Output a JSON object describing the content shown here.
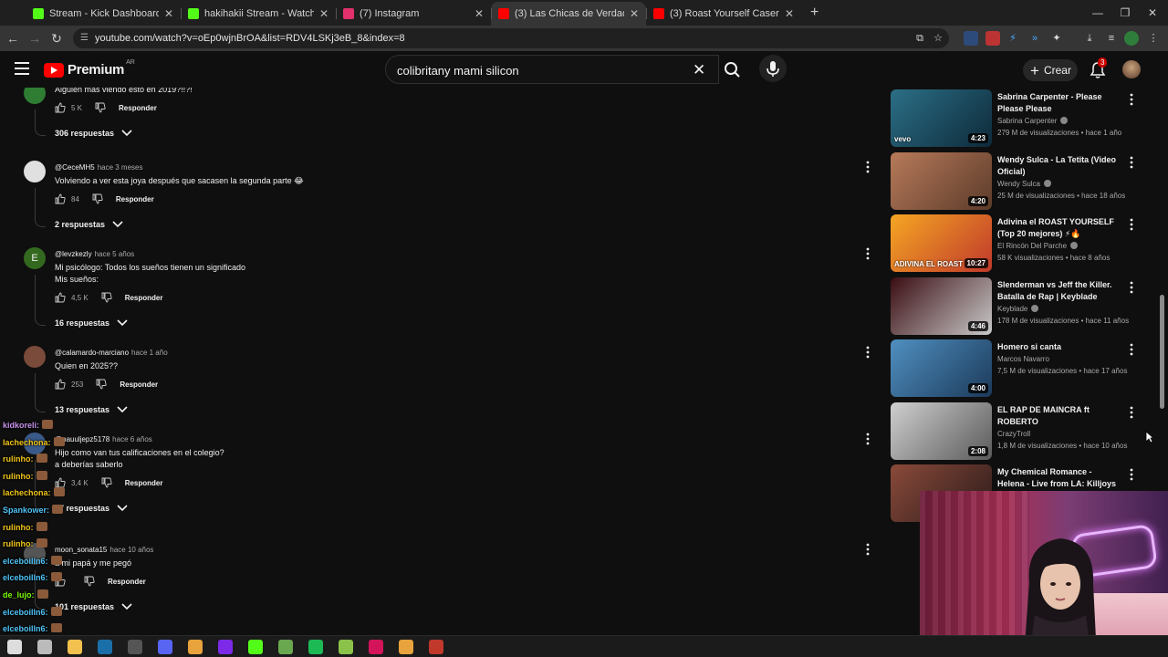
{
  "browser": {
    "tabs": [
      {
        "label": "Stream - Kick Dashboard",
        "favicon_color": "#53fc18",
        "active": false
      },
      {
        "label": "hakihakii Stream - Watch Live o",
        "favicon_color": "#53fc18",
        "active": false
      },
      {
        "label": "(7) Instagram",
        "favicon_color": "#e1306c",
        "active": false
      },
      {
        "label": "(3) Las Chicas de Verdad nos G",
        "favicon_color": "#ff0000",
        "active": true
      },
      {
        "label": "(3) Roast Yourself Casero - La F",
        "favicon_color": "#ff0000",
        "active": false
      }
    ],
    "url": "youtube.com/watch?v=oEp0wjnBrOA&list=RDV4LSKj3eB_8&index=8"
  },
  "youtube": {
    "logo_text": "Premium",
    "country_code": "AR",
    "search_value": "colibritany mami silicon",
    "create_label": "Crear",
    "notification_count": "3"
  },
  "comments": [
    {
      "author": "",
      "time": "",
      "text": [
        "Alguien mas viendo esto en 2019?!!?!"
      ],
      "likes": "5 K",
      "reply_label": "Responder",
      "replies": "306 respuestas",
      "avatar_color": "#2e7d32",
      "avatar_letter": ""
    },
    {
      "author": "@CeceMH5",
      "time": "hace 3 meses",
      "text": [
        "Volviendo a ver esta joya después que sacasen la segunda parte 😂"
      ],
      "likes": "84",
      "reply_label": "Responder",
      "replies": "2 respuestas",
      "avatar_color": "#e0e0e0",
      "avatar_letter": ""
    },
    {
      "author": "@levzkezly",
      "time": "hace 5 años",
      "text": [
        "Mi psicólogo: Todos los sueños tienen un significado",
        "Mis sueños:"
      ],
      "likes": "4,5 K",
      "reply_label": "Responder",
      "replies": "16 respuestas",
      "avatar_color": "#33691e",
      "avatar_letter": "E"
    },
    {
      "author": "@calamardo-marciano",
      "time": "hace 1 año",
      "text": [
        "Quien en 2025??"
      ],
      "likes": "253",
      "reply_label": "Responder",
      "replies": "13 respuestas",
      "avatar_color": "#7a4a3a",
      "avatar_letter": ""
    },
    {
      "author": "@nauuljepz5178",
      "time": "hace 6 años",
      "text": [
        "Hijo como van tus calificaciones en el colegio?",
        "a deberías saberlo"
      ],
      "likes": "3,4 K",
      "reply_label": "Responder",
      "replies": "17 respuestas",
      "avatar_color": "#3a5a8a",
      "avatar_letter": ""
    },
    {
      "author": "moon_sonata15",
      "time": "hace 10 años",
      "text": [
        "a mi papá y me pegó"
      ],
      "likes": "",
      "reply_label": "Responder",
      "replies": "101 respuestas",
      "avatar_color": "#555555",
      "avatar_letter": ""
    }
  ],
  "recommendations": [
    {
      "title": "Sabrina Carpenter - Please Please Please",
      "channel": "Sabrina Carpenter",
      "verified": true,
      "meta": "279 M de visualizaciones • hace 1 año",
      "duration": "4:23",
      "badge": "vevo",
      "thumb_colors": [
        "#2b6f86",
        "#0e2a3a"
      ]
    },
    {
      "title": "Wendy Sulca - La Tetita (Video Oficial)",
      "channel": "Wendy Sulca",
      "verified": true,
      "meta": "25 M de visualizaciones • hace 18 años",
      "duration": "4:20",
      "badge": "",
      "thumb_colors": [
        "#b77a5a",
        "#5c3b2a"
      ]
    },
    {
      "title": "Adivina el ROAST YOURSELF (Top 20 mejores) ⚡🔥",
      "channel": "El Rincón Del Parche",
      "verified": true,
      "meta": "58 K visualizaciones • hace 8 años",
      "duration": "10:27",
      "badge": "ADIVINA EL ROAST",
      "thumb_colors": [
        "#f5a623",
        "#c0392b"
      ]
    },
    {
      "title": "Slenderman vs Jeff the Killer. Batalla de Rap | Keyblade",
      "channel": "Keyblade",
      "verified": true,
      "meta": "178 M de visualizaciones • hace 11 años",
      "duration": "4:46",
      "badge": "",
      "thumb_colors": [
        "#3a0d12",
        "#c9c9c9"
      ]
    },
    {
      "title": "Homero si canta",
      "channel": "Marcos Navarro",
      "verified": false,
      "meta": "7,5 M de visualizaciones • hace 17 años",
      "duration": "4:00",
      "badge": "",
      "thumb_colors": [
        "#4f8fc0",
        "#1c3a5a"
      ]
    },
    {
      "title": "EL RAP DE MAINCRA ft ROBERTO",
      "channel": "CrazyTroll",
      "verified": false,
      "meta": "1,8 M de visualizaciones • hace 10 años",
      "duration": "2:08",
      "badge": "",
      "thumb_colors": [
        "#cfcfcf",
        "#5a5a5a"
      ]
    },
    {
      "title": "My Chemical Romance - Helena - Live from LA: Killjoys Make ...",
      "channel": "",
      "verified": false,
      "meta": "",
      "duration": "",
      "badge": "",
      "thumb_colors": [
        "#8a4a3a",
        "#2a1a1a"
      ]
    }
  ],
  "chat": [
    {
      "user": "kidkoreli:",
      "color": "#c792ea",
      "msg": "",
      "emote": true
    },
    {
      "user": "lachechona:",
      "color": "#f0c419",
      "msg": "",
      "emote": true
    },
    {
      "user": "rulinho:",
      "color": "#f0c419",
      "msg": "",
      "emote": true
    },
    {
      "user": "rulinho:",
      "color": "#f0c419",
      "msg": "",
      "emote": true
    },
    {
      "user": "lachechona:",
      "color": "#f0c419",
      "msg": "",
      "emote": true
    },
    {
      "user": "Spankower:",
      "color": "#4fc3f7",
      "msg": "",
      "emote": true
    },
    {
      "user": "rulinho:",
      "color": "#f0c419",
      "msg": "",
      "emote": true
    },
    {
      "user": "rulinho:",
      "color": "#f0c419",
      "msg": "",
      "emote": true
    },
    {
      "user": "elceboilln6:",
      "color": "#4fc3f7",
      "msg": "",
      "emote": true
    },
    {
      "user": "elceboilln6:",
      "color": "#4fc3f7",
      "msg": "",
      "emote": true
    },
    {
      "user": "de_lujo:",
      "color": "#7cfc00",
      "msg": "",
      "emote": true
    },
    {
      "user": "elceboilln6:",
      "color": "#4fc3f7",
      "msg": "",
      "emote": true
    },
    {
      "user": "elceboilln6:",
      "color": "#4fc3f7",
      "msg": "",
      "emote": true
    },
    {
      "user": "elceboilln6:",
      "color": "#4fc3f7",
      "msg": "",
      "emote": true
    }
  ],
  "taskbar_icons": [
    {
      "name": "windows-start-icon",
      "color": "#dddddd"
    },
    {
      "name": "search-taskbar-icon",
      "color": "#bbbbbb"
    },
    {
      "name": "file-explorer-icon",
      "color": "#f2c14e"
    },
    {
      "name": "steam-icon",
      "color": "#1b6fa8"
    },
    {
      "name": "obs-icon",
      "color": "#555555"
    },
    {
      "name": "discord-icon",
      "color": "#5865f2"
    },
    {
      "name": "chrome-icon",
      "color": "#e8a33c"
    },
    {
      "name": "canva-icon",
      "color": "#7d2ae8"
    },
    {
      "name": "kick-icon",
      "color": "#53fc18"
    },
    {
      "name": "minecraft-icon",
      "color": "#6aa84f"
    },
    {
      "name": "spotify-icon",
      "color": "#1db954"
    },
    {
      "name": "xbox-app-icon",
      "color": "#8bc34a"
    },
    {
      "name": "opera-gx-icon",
      "color": "#d4145a"
    },
    {
      "name": "chrome-active-icon",
      "color": "#e8a33c"
    },
    {
      "name": "media-app-icon",
      "color": "#c0392b"
    }
  ]
}
